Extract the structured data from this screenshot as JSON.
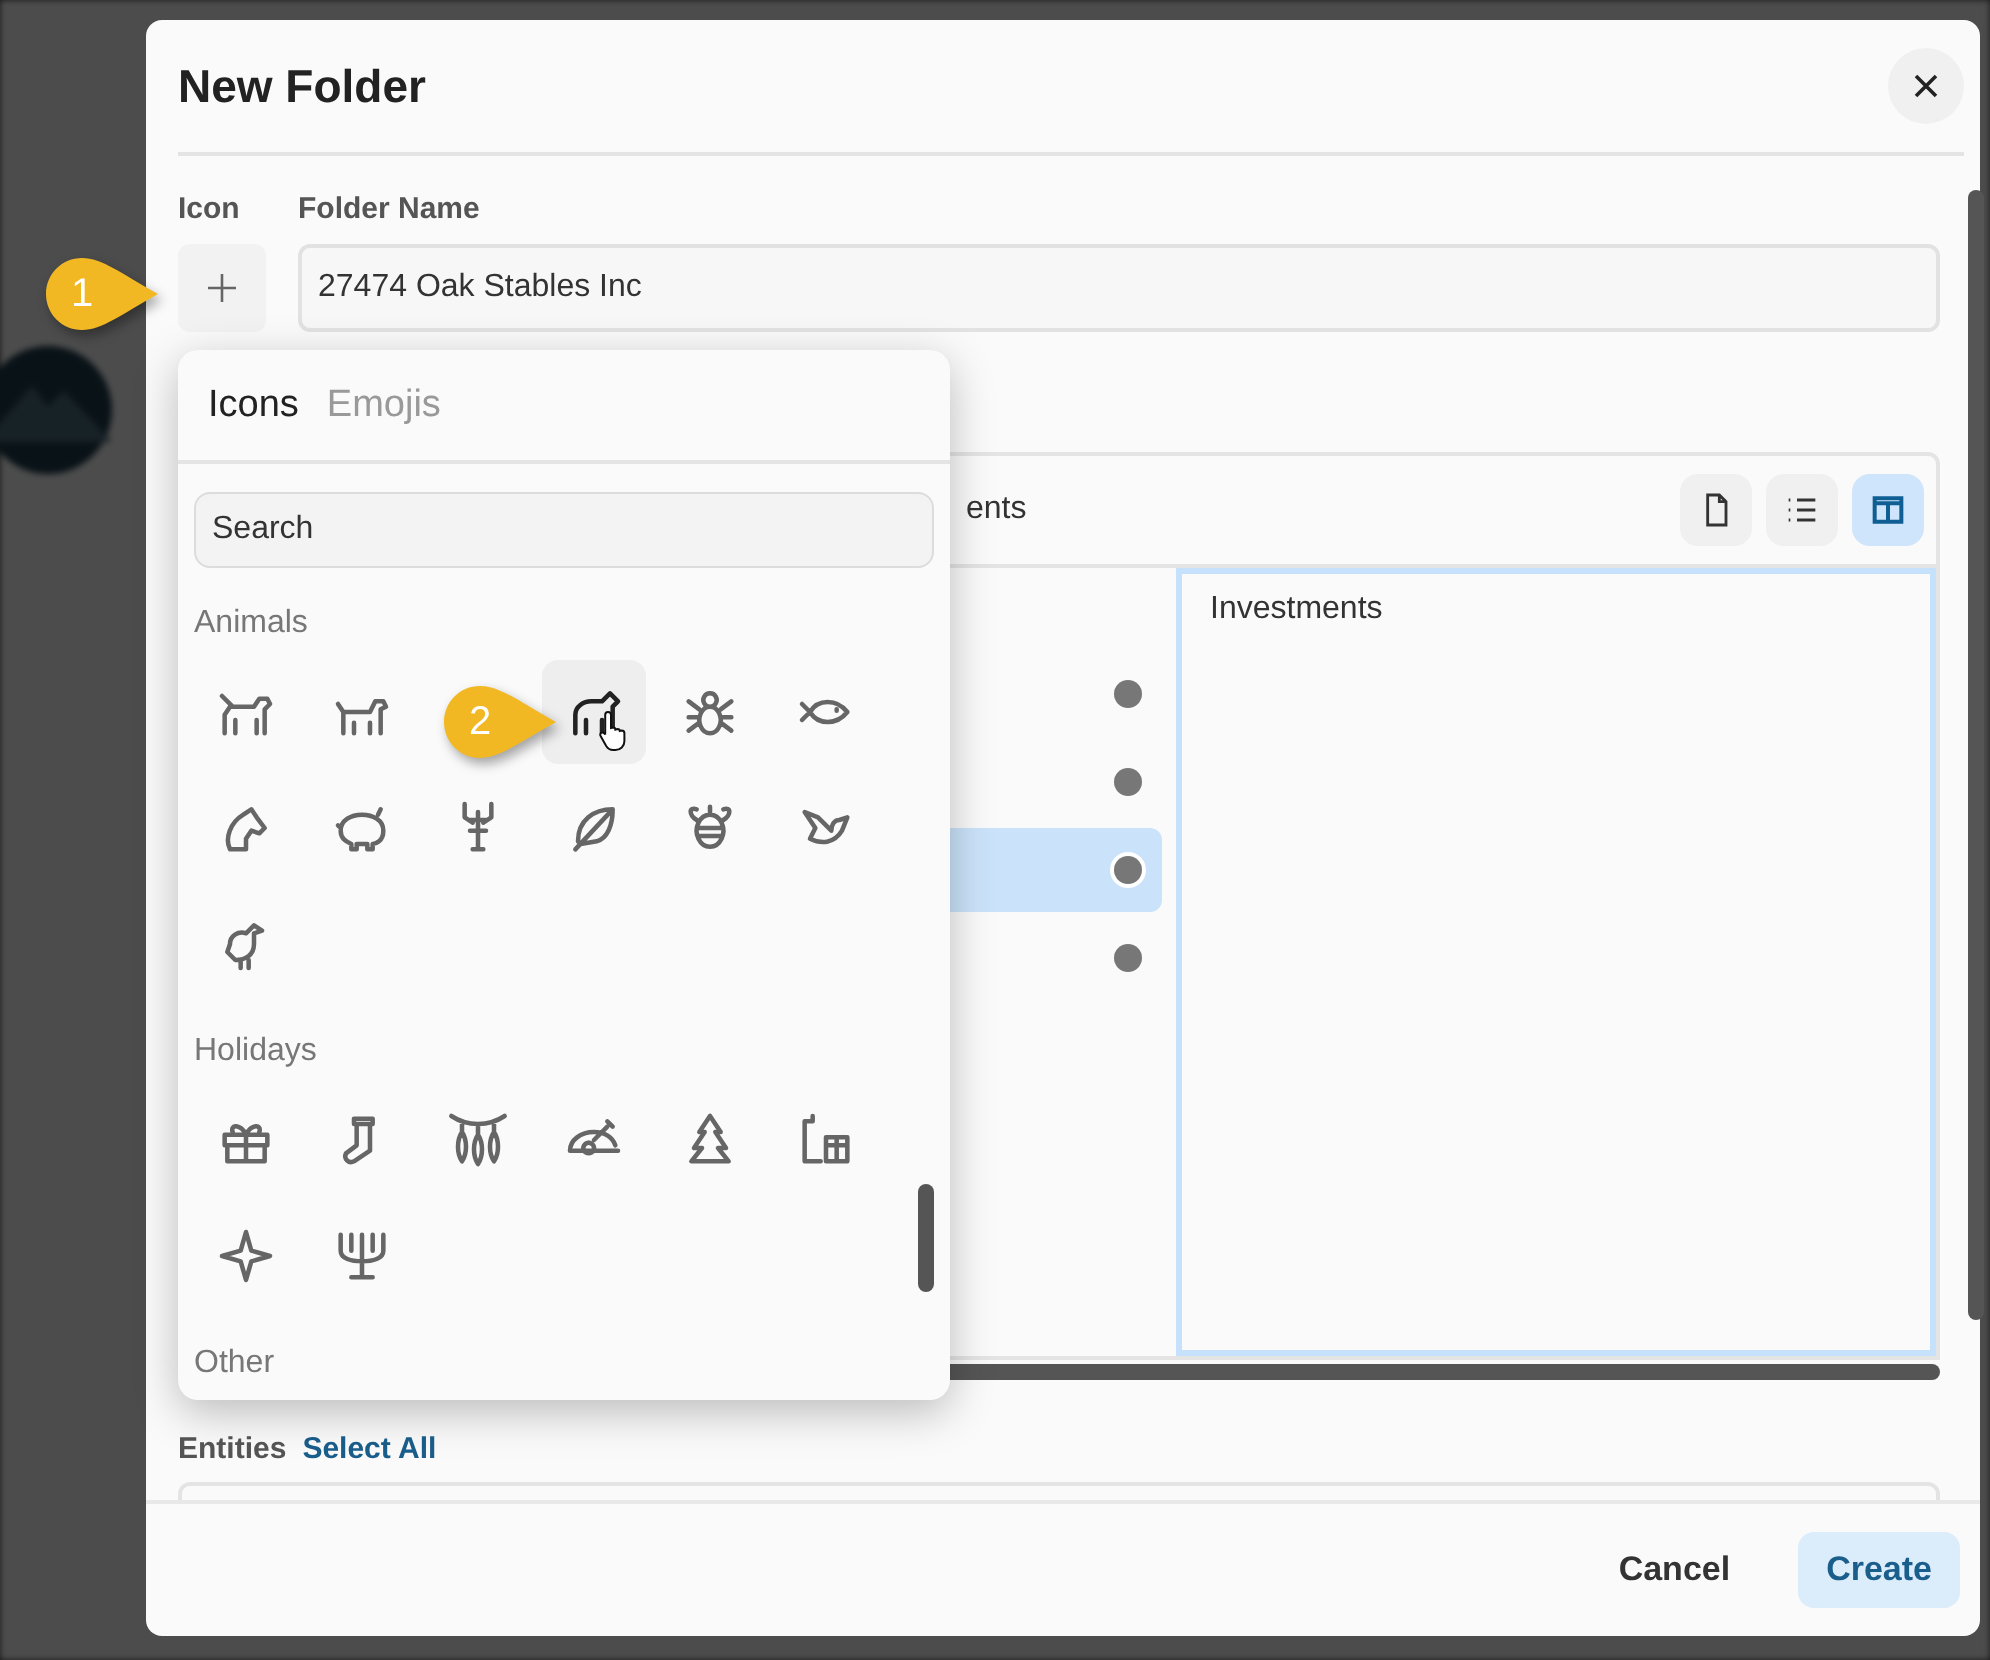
{
  "dialog": {
    "title": "New Folder"
  },
  "icon_label": "Icon",
  "name_label": "Folder Name",
  "folder_name": "27474 Oak Stables Inc",
  "picker": {
    "tabs": [
      {
        "label": "Icons",
        "selected": true
      },
      {
        "label": "Emojis",
        "selected": false
      }
    ],
    "search": {
      "placeholder": "Search"
    },
    "groups": [
      {
        "title": "Animals",
        "icons": [
          {
            "hovered": false
          },
          {
            "hovered": false
          },
          {
            "kind": "callout",
            "label": "2"
          },
          {
            "hovered": true
          },
          {
            "hovered": false
          },
          {
            "hovered": false
          },
          {
            "hovered": false
          },
          {
            "hovered": false
          },
          {
            "hovered": false
          },
          {
            "hovered": false
          },
          {
            "hovered": false
          },
          {
            "hovered": false
          },
          {
            "hovered": false
          }
        ]
      },
      {
        "title": "Holidays",
        "icons": [
          {
            "hovered": false
          },
          {
            "hovered": false
          },
          {
            "hovered": false
          },
          {
            "hovered": false
          },
          {
            "hovered": false
          },
          {
            "hovered": false
          },
          {
            "hovered": false
          },
          {
            "hovered": false
          }
        ]
      },
      {
        "title": "Other"
      }
    ]
  },
  "panel": {
    "title": "ents",
    "views": [
      {
        "selected": false
      },
      {
        "selected": false
      },
      {
        "selected": true
      }
    ],
    "rows": [
      {
        "selected": false
      },
      {
        "selected": false
      },
      {
        "selected": true
      },
      {
        "selected": false
      }
    ],
    "preview": "Investments"
  },
  "entities": {
    "label": "Entities",
    "link": "Select All"
  },
  "buttons": [
    {
      "label": "Cancel",
      "kind": "text"
    },
    {
      "label": "Create",
      "kind": "primary"
    }
  ],
  "callouts": [
    {
      "label": "1"
    }
  ]
}
